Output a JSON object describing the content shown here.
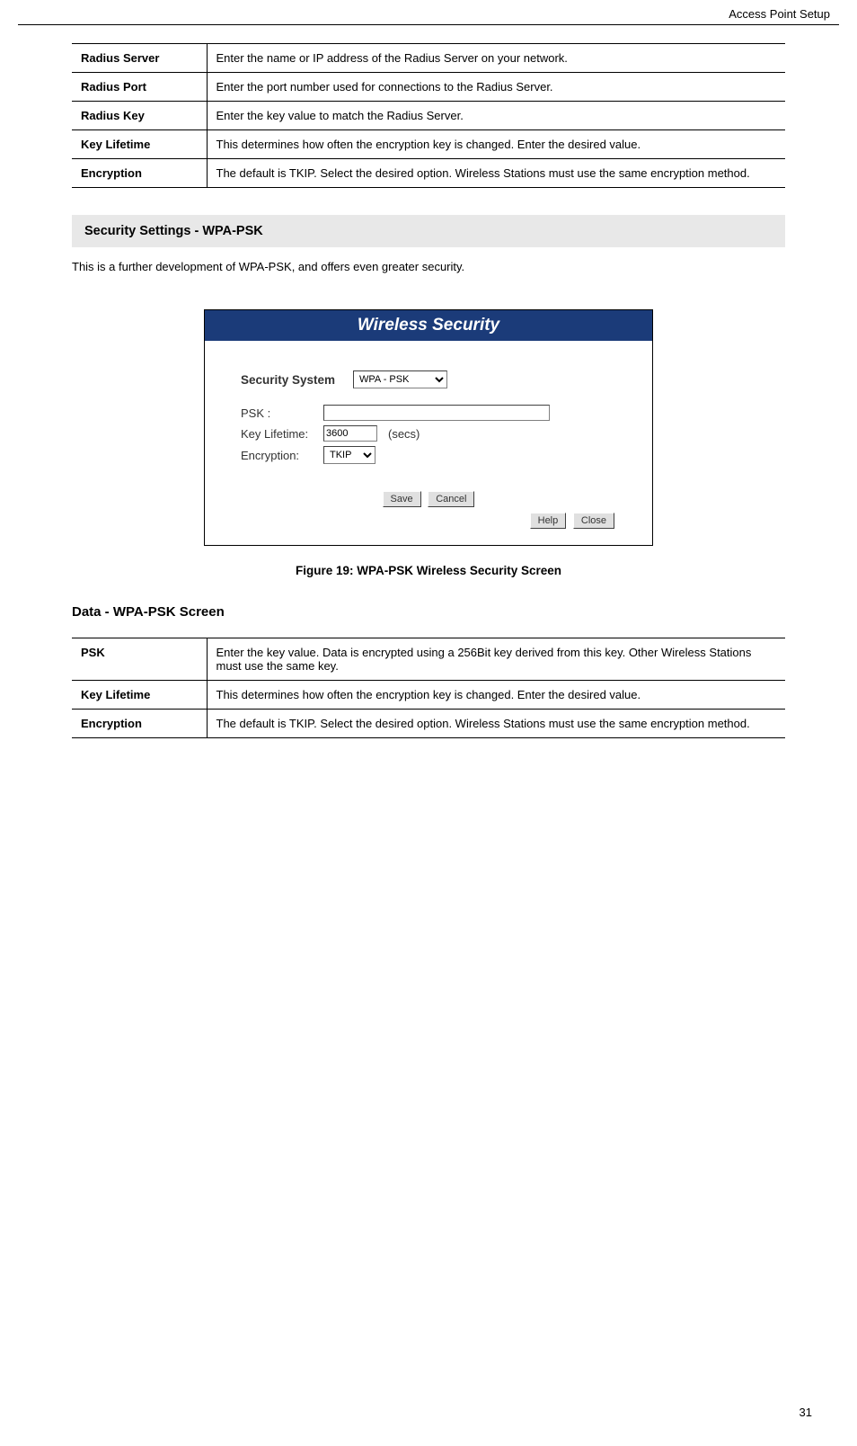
{
  "header": {
    "chapter": "Access Point Setup"
  },
  "page_number": "31",
  "table1": [
    {
      "th": "Radius Server",
      "td": "Enter the name or IP address of the Radius Server on your network."
    },
    {
      "th": "Radius Port",
      "td": "Enter the port number used for connections to the Radius Server."
    },
    {
      "th": "Radius Key",
      "td": "Enter the key value to match the Radius Server."
    },
    {
      "th": "Key Lifetime",
      "td": "This determines how often the encryption key is changed. Enter the desired value."
    },
    {
      "th": "Encryption",
      "td": "The default is TKIP. Select the desired option. Wireless Stations must use the same encryption method."
    }
  ],
  "section": {
    "heading": "Security Settings - WPA-PSK",
    "note": "This is a further development of WPA-PSK, and offers even greater security."
  },
  "screenshot": {
    "title": "Wireless Security",
    "security_system_label": "Security System",
    "security_system_value": "WPA - PSK",
    "psk_label": "PSK :",
    "psk_value": "",
    "key_lifetime_label": "Key Lifetime:",
    "key_lifetime_value": "3600",
    "key_lifetime_unit": "(secs)",
    "encryption_label": "Encryption:",
    "encryption_value": "TKIP",
    "buttons": {
      "save": "Save",
      "cancel": "Cancel",
      "help": "Help",
      "close": "Close"
    }
  },
  "figure_caption": "Figure 19: WPA-PSK Wireless Security Screen",
  "data_heading": "Data - WPA-PSK Screen",
  "table2": [
    {
      "th": "PSK",
      "td": "Enter the key value. Data is encrypted using a 256Bit key derived from this key. Other Wireless Stations must use the same key."
    },
    {
      "th": "Key Lifetime",
      "td": "This determines how often the encryption key is changed. Enter the desired value."
    },
    {
      "th": "Encryption",
      "td": "The default is TKIP. Select the desired option. Wireless Stations must use the same encryption method."
    }
  ]
}
